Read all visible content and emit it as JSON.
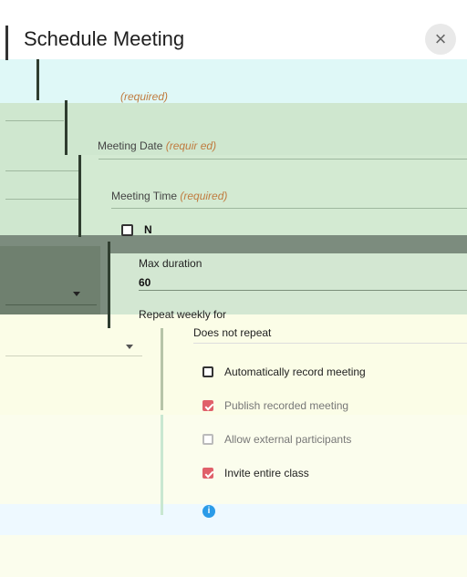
{
  "dialog": {
    "title": "Schedule Meeting",
    "close_icon": "×"
  },
  "fields": {
    "required_suffix": "(required)",
    "date_label": "Meeting Date",
    "time_label": "Meeting Time",
    "date_required": "(requir  ed)",
    "time_required": "(required)"
  },
  "options": {
    "checkbox_label": "N"
  },
  "max_duration": {
    "label": "Max duration",
    "value": "60"
  },
  "repeat": {
    "label": "Repeat weekly for",
    "value": "Does not repeat"
  },
  "checkboxes": [
    {
      "label": "Automatically record meeting",
      "checked": false,
      "disabled": false
    },
    {
      "label": "Publish recorded meeting",
      "checked": true,
      "disabled": false
    },
    {
      "label": "Allow external participants",
      "checked": false,
      "disabled": true
    },
    {
      "label": "Invite entire class",
      "checked": true,
      "disabled": false
    }
  ],
  "colors": {
    "accent": "#e0606a",
    "info": "#2b9be8"
  }
}
